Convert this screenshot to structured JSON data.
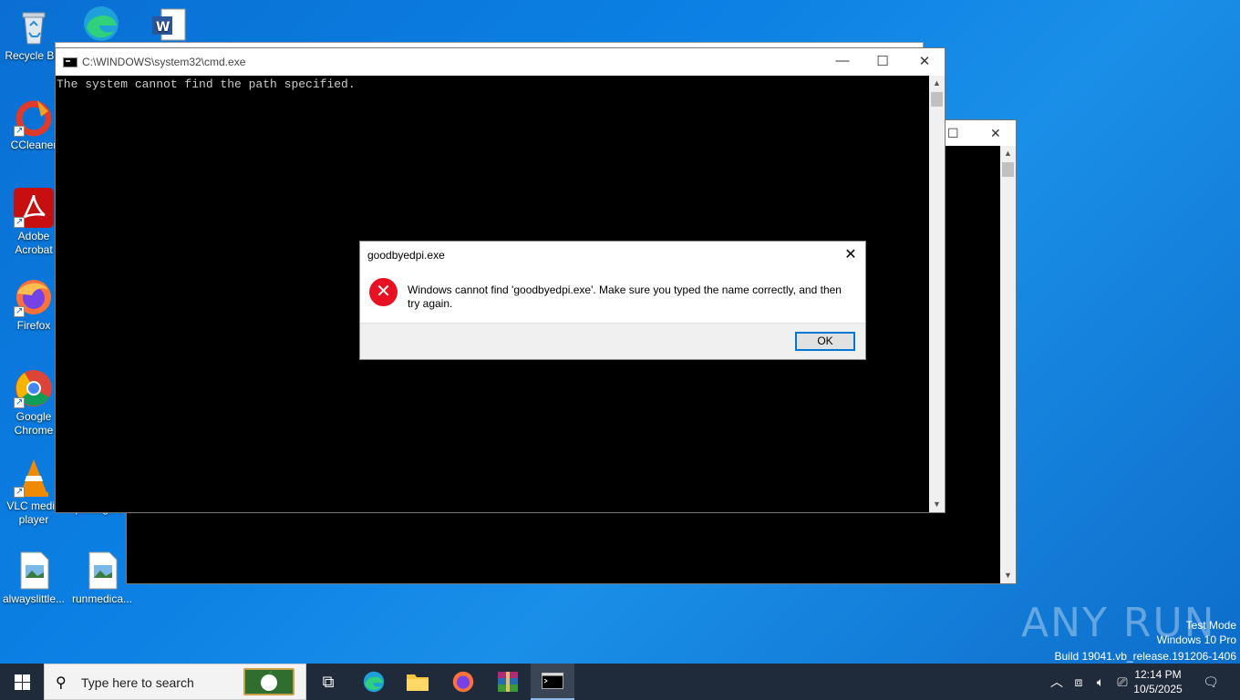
{
  "desktop": {
    "icons": [
      {
        "label": "Recycle Bin",
        "name": "recycle-bin-icon"
      },
      {
        "label": "CCleaner",
        "name": "ccleaner-icon"
      },
      {
        "label": "Adobe Acrobat",
        "name": "adobe-acrobat-icon"
      },
      {
        "label": "Firefox",
        "name": "firefox-icon"
      },
      {
        "label": "Google Chrome",
        "name": "google-chrome-icon"
      },
      {
        "label": "VLC media player",
        "name": "vlc-icon"
      },
      {
        "label": "alwayslittle...",
        "name": "image-file-icon"
      },
      {
        "label": "runmedica...",
        "name": "image-file-icon"
      },
      {
        "label": "photogers",
        "name": "photogers-icon"
      }
    ]
  },
  "cmd_window": {
    "title": "C:\\WINDOWS\\system32\\cmd.exe",
    "output": "The system cannot find the path specified.",
    "minimize": "—",
    "maximize": "☐",
    "close": "✕"
  },
  "back_window": {
    "maximize": "☐",
    "close": "✕"
  },
  "dialog": {
    "title": "goodbyedpi.exe",
    "message": "Windows cannot find 'goodbyedpi.exe'. Make sure you typed the name correctly, and then try again.",
    "ok_label": "OK",
    "close": "✕"
  },
  "watermark": {
    "text": "ANY RUN",
    "mode": "Test Mode",
    "edition": "Windows 10 Pro",
    "build": "Build 19041.vb_release.191206-1406"
  },
  "taskbar": {
    "search_placeholder": "Type here to search",
    "clock_time": "12:14 PM",
    "clock_date": "10/5/2025"
  },
  "colors": {
    "desktop": "#0b7fe3",
    "taskbar": "#1f2a3a",
    "error": "#e81123",
    "accent": "#0078d7"
  }
}
